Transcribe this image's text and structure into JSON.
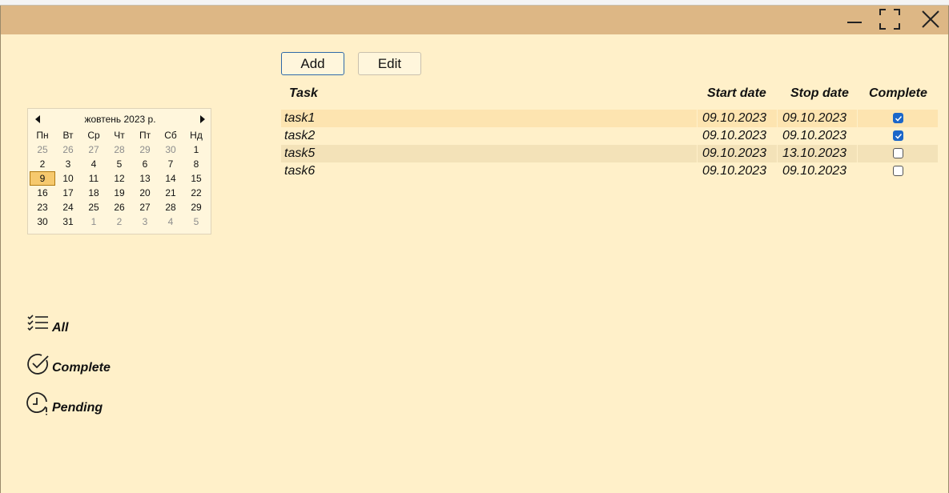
{
  "window": {
    "controls": {
      "minimize": "minimize-icon",
      "maximize": "maximize-icon",
      "close": "close-icon"
    }
  },
  "toolbar": {
    "add_label": "Add",
    "edit_label": "Edit"
  },
  "calendar": {
    "month_label": "жовтень 2023 р.",
    "weekdays": [
      "Пн",
      "Вт",
      "Ср",
      "Чт",
      "Пт",
      "Сб",
      "Нд"
    ],
    "weeks": [
      [
        "25",
        "26",
        "27",
        "28",
        "29",
        "30",
        "1"
      ],
      [
        "2",
        "3",
        "4",
        "5",
        "6",
        "7",
        "8"
      ],
      [
        "9",
        "10",
        "11",
        "12",
        "13",
        "14",
        "15"
      ],
      [
        "16",
        "17",
        "18",
        "19",
        "20",
        "21",
        "22"
      ],
      [
        "23",
        "24",
        "25",
        "26",
        "27",
        "28",
        "29"
      ],
      [
        "30",
        "31",
        "1",
        "2",
        "3",
        "4",
        "5"
      ]
    ],
    "selected_day": "9"
  },
  "filters": [
    {
      "label": "All",
      "icon": "checklist-icon"
    },
    {
      "label": "Complete",
      "icon": "check-circle-icon"
    },
    {
      "label": "Pending",
      "icon": "clock-pending-icon"
    }
  ],
  "table": {
    "headers": {
      "task": "Task",
      "start": "Start date",
      "stop": "Stop date",
      "complete": "Complete"
    },
    "rows": [
      {
        "task": "task1",
        "start": "09.10.2023",
        "stop": "09.10.2023",
        "complete": true
      },
      {
        "task": "task2",
        "start": "09.10.2023",
        "stop": "09.10.2023",
        "complete": true
      },
      {
        "task": "task5",
        "start": "09.10.2023",
        "stop": "13.10.2023",
        "complete": false
      },
      {
        "task": "task6",
        "start": "09.10.2023",
        "stop": "09.10.2023",
        "complete": false
      }
    ]
  },
  "colors": {
    "background": "#fff0c9",
    "titlebar": "#ddb785",
    "selected_row": "#fde4b0",
    "alt_row": "#f3e2b8",
    "checkbox_on": "#1b66c9",
    "calendar_selected": "#f6c96e"
  }
}
